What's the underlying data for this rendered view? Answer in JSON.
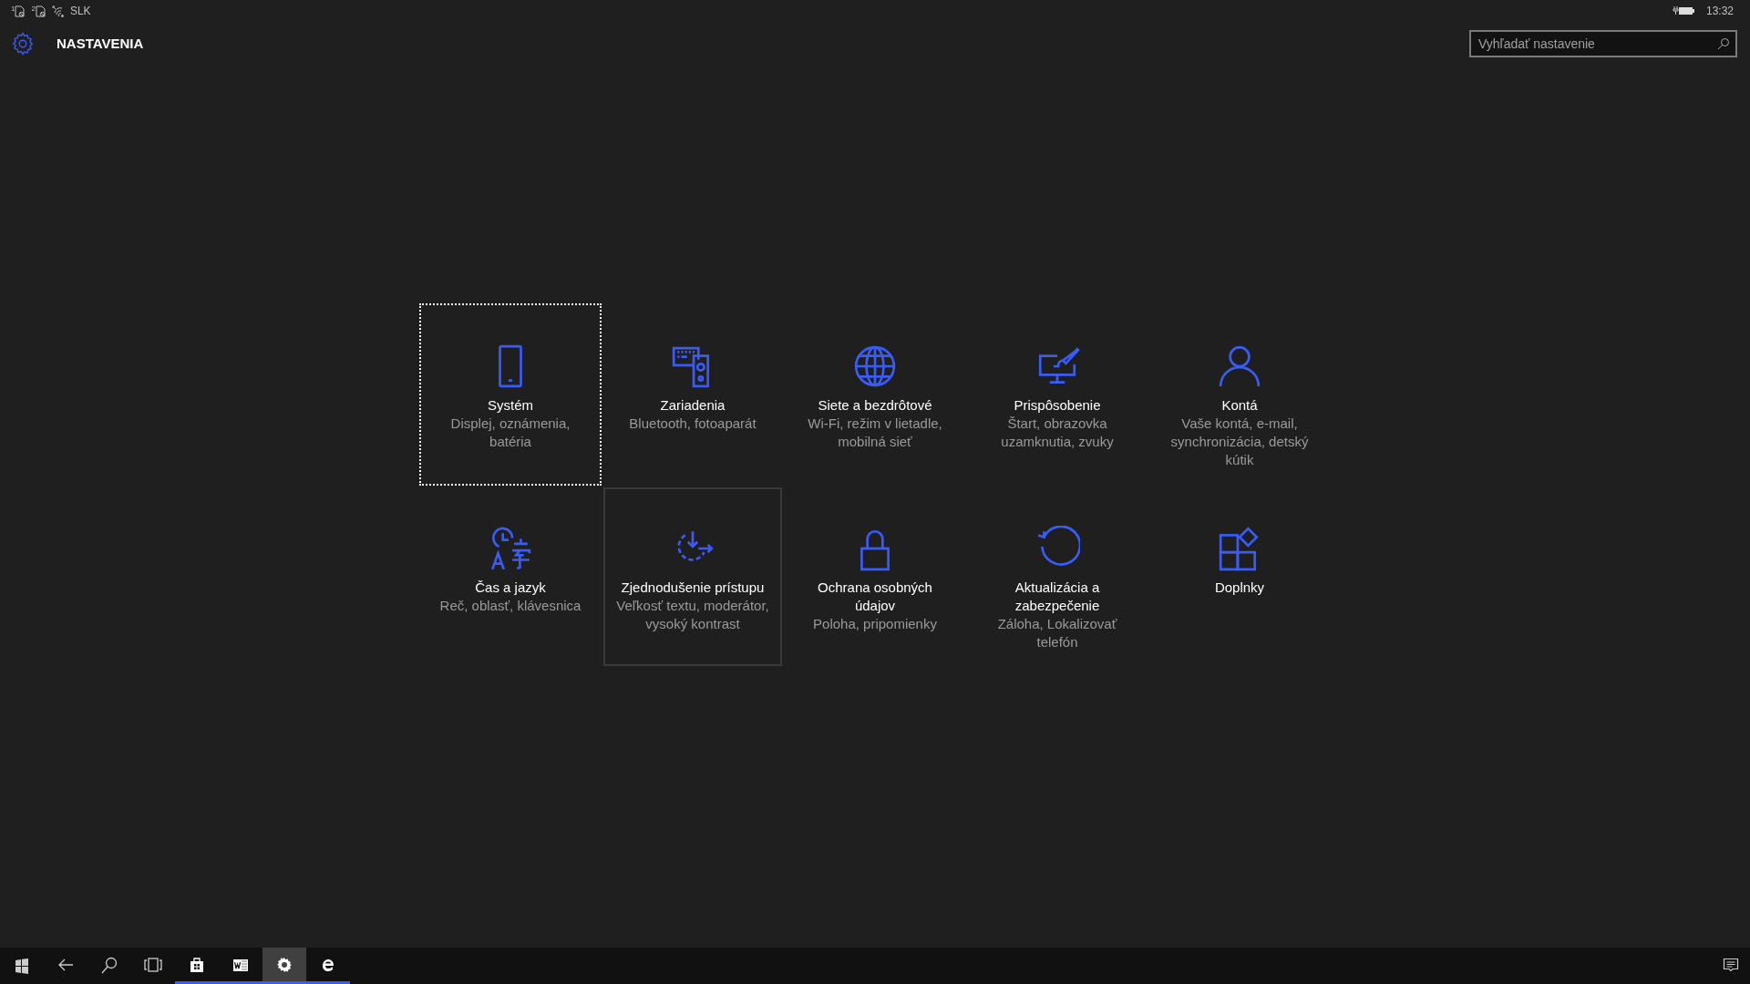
{
  "status_bar": {
    "sim_slots": [
      "1",
      "2"
    ],
    "carrier": "SLK",
    "time": "13:32"
  },
  "header": {
    "title": "NASTAVENIA",
    "search": {
      "placeholder": "Vyhľadať nastavenie"
    }
  },
  "categories": [
    {
      "kind": "phone",
      "title": "Systém",
      "subtitle": "Displej, oznámenia, batéria",
      "focused": true,
      "hovered": false
    },
    {
      "kind": "devices",
      "title": "Zariadenia",
      "subtitle": "Bluetooth, fotoaparát",
      "focused": false,
      "hovered": false
    },
    {
      "kind": "globe",
      "title": "Siete a bezdrôtové",
      "subtitle": "Wi-Fi, režim v lietadle, mobilná sieť",
      "focused": false,
      "hovered": false
    },
    {
      "kind": "brush",
      "title": "Prispôsobenie",
      "subtitle": "Štart, obrazovka uzamknutia, zvuky",
      "focused": false,
      "hovered": false
    },
    {
      "kind": "person",
      "title": "Kontá",
      "subtitle": "Vaše kontá, e-mail, synchronizácia, detský kútik",
      "focused": false,
      "hovered": false
    },
    {
      "kind": "clock",
      "title": "Čas a jazyk",
      "subtitle": "Reč, oblasť, klávesnica",
      "focused": false,
      "hovered": false
    },
    {
      "kind": "access",
      "title": "Zjednodušenie prístupu",
      "subtitle": "Veľkosť textu, moderátor, vysoký kontrast",
      "focused": false,
      "hovered": true
    },
    {
      "kind": "lock",
      "title": "Ochrana osobných údajov",
      "subtitle": "Poloha, pripomienky",
      "focused": false,
      "hovered": false
    },
    {
      "kind": "update",
      "title": "Aktualizácia a zabezpečenie",
      "subtitle": "Záloha, Lokalizovať telefón",
      "focused": false,
      "hovered": false
    },
    {
      "kind": "addons",
      "title": "Doplnky",
      "focused": false,
      "hovered": false
    }
  ],
  "taskbar": [
    {
      "kind": "start",
      "running": false,
      "selected": false
    },
    {
      "kind": "back",
      "running": false,
      "selected": false
    },
    {
      "kind": "search",
      "running": false,
      "selected": false
    },
    {
      "kind": "taskview",
      "running": false,
      "selected": false
    },
    {
      "kind": "store",
      "running": true,
      "selected": false
    },
    {
      "kind": "word",
      "running": true,
      "selected": false
    },
    {
      "kind": "settings",
      "running": true,
      "selected": true
    },
    {
      "kind": "edge",
      "running": true,
      "selected": false
    }
  ]
}
